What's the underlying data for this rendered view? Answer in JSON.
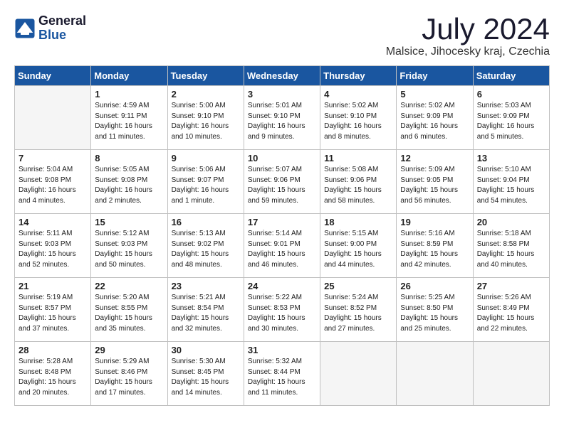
{
  "header": {
    "logo_line1": "General",
    "logo_line2": "Blue",
    "month_title": "July 2024",
    "location": "Malsice, Jihocesky kraj, Czechia"
  },
  "days_of_week": [
    "Sunday",
    "Monday",
    "Tuesday",
    "Wednesday",
    "Thursday",
    "Friday",
    "Saturday"
  ],
  "weeks": [
    [
      {
        "day": "",
        "empty": true
      },
      {
        "day": "1",
        "sunrise": "Sunrise: 4:59 AM",
        "sunset": "Sunset: 9:11 PM",
        "daylight": "Daylight: 16 hours and 11 minutes."
      },
      {
        "day": "2",
        "sunrise": "Sunrise: 5:00 AM",
        "sunset": "Sunset: 9:10 PM",
        "daylight": "Daylight: 16 hours and 10 minutes."
      },
      {
        "day": "3",
        "sunrise": "Sunrise: 5:01 AM",
        "sunset": "Sunset: 9:10 PM",
        "daylight": "Daylight: 16 hours and 9 minutes."
      },
      {
        "day": "4",
        "sunrise": "Sunrise: 5:02 AM",
        "sunset": "Sunset: 9:10 PM",
        "daylight": "Daylight: 16 hours and 8 minutes."
      },
      {
        "day": "5",
        "sunrise": "Sunrise: 5:02 AM",
        "sunset": "Sunset: 9:09 PM",
        "daylight": "Daylight: 16 hours and 6 minutes."
      },
      {
        "day": "6",
        "sunrise": "Sunrise: 5:03 AM",
        "sunset": "Sunset: 9:09 PM",
        "daylight": "Daylight: 16 hours and 5 minutes."
      }
    ],
    [
      {
        "day": "7",
        "sunrise": "Sunrise: 5:04 AM",
        "sunset": "Sunset: 9:08 PM",
        "daylight": "Daylight: 16 hours and 4 minutes."
      },
      {
        "day": "8",
        "sunrise": "Sunrise: 5:05 AM",
        "sunset": "Sunset: 9:08 PM",
        "daylight": "Daylight: 16 hours and 2 minutes."
      },
      {
        "day": "9",
        "sunrise": "Sunrise: 5:06 AM",
        "sunset": "Sunset: 9:07 PM",
        "daylight": "Daylight: 16 hours and 1 minute."
      },
      {
        "day": "10",
        "sunrise": "Sunrise: 5:07 AM",
        "sunset": "Sunset: 9:06 PM",
        "daylight": "Daylight: 15 hours and 59 minutes."
      },
      {
        "day": "11",
        "sunrise": "Sunrise: 5:08 AM",
        "sunset": "Sunset: 9:06 PM",
        "daylight": "Daylight: 15 hours and 58 minutes."
      },
      {
        "day": "12",
        "sunrise": "Sunrise: 5:09 AM",
        "sunset": "Sunset: 9:05 PM",
        "daylight": "Daylight: 15 hours and 56 minutes."
      },
      {
        "day": "13",
        "sunrise": "Sunrise: 5:10 AM",
        "sunset": "Sunset: 9:04 PM",
        "daylight": "Daylight: 15 hours and 54 minutes."
      }
    ],
    [
      {
        "day": "14",
        "sunrise": "Sunrise: 5:11 AM",
        "sunset": "Sunset: 9:03 PM",
        "daylight": "Daylight: 15 hours and 52 minutes."
      },
      {
        "day": "15",
        "sunrise": "Sunrise: 5:12 AM",
        "sunset": "Sunset: 9:03 PM",
        "daylight": "Daylight: 15 hours and 50 minutes."
      },
      {
        "day": "16",
        "sunrise": "Sunrise: 5:13 AM",
        "sunset": "Sunset: 9:02 PM",
        "daylight": "Daylight: 15 hours and 48 minutes."
      },
      {
        "day": "17",
        "sunrise": "Sunrise: 5:14 AM",
        "sunset": "Sunset: 9:01 PM",
        "daylight": "Daylight: 15 hours and 46 minutes."
      },
      {
        "day": "18",
        "sunrise": "Sunrise: 5:15 AM",
        "sunset": "Sunset: 9:00 PM",
        "daylight": "Daylight: 15 hours and 44 minutes."
      },
      {
        "day": "19",
        "sunrise": "Sunrise: 5:16 AM",
        "sunset": "Sunset: 8:59 PM",
        "daylight": "Daylight: 15 hours and 42 minutes."
      },
      {
        "day": "20",
        "sunrise": "Sunrise: 5:18 AM",
        "sunset": "Sunset: 8:58 PM",
        "daylight": "Daylight: 15 hours and 40 minutes."
      }
    ],
    [
      {
        "day": "21",
        "sunrise": "Sunrise: 5:19 AM",
        "sunset": "Sunset: 8:57 PM",
        "daylight": "Daylight: 15 hours and 37 minutes."
      },
      {
        "day": "22",
        "sunrise": "Sunrise: 5:20 AM",
        "sunset": "Sunset: 8:55 PM",
        "daylight": "Daylight: 15 hours and 35 minutes."
      },
      {
        "day": "23",
        "sunrise": "Sunrise: 5:21 AM",
        "sunset": "Sunset: 8:54 PM",
        "daylight": "Daylight: 15 hours and 32 minutes."
      },
      {
        "day": "24",
        "sunrise": "Sunrise: 5:22 AM",
        "sunset": "Sunset: 8:53 PM",
        "daylight": "Daylight: 15 hours and 30 minutes."
      },
      {
        "day": "25",
        "sunrise": "Sunrise: 5:24 AM",
        "sunset": "Sunset: 8:52 PM",
        "daylight": "Daylight: 15 hours and 27 minutes."
      },
      {
        "day": "26",
        "sunrise": "Sunrise: 5:25 AM",
        "sunset": "Sunset: 8:50 PM",
        "daylight": "Daylight: 15 hours and 25 minutes."
      },
      {
        "day": "27",
        "sunrise": "Sunrise: 5:26 AM",
        "sunset": "Sunset: 8:49 PM",
        "daylight": "Daylight: 15 hours and 22 minutes."
      }
    ],
    [
      {
        "day": "28",
        "sunrise": "Sunrise: 5:28 AM",
        "sunset": "Sunset: 8:48 PM",
        "daylight": "Daylight: 15 hours and 20 minutes."
      },
      {
        "day": "29",
        "sunrise": "Sunrise: 5:29 AM",
        "sunset": "Sunset: 8:46 PM",
        "daylight": "Daylight: 15 hours and 17 minutes."
      },
      {
        "day": "30",
        "sunrise": "Sunrise: 5:30 AM",
        "sunset": "Sunset: 8:45 PM",
        "daylight": "Daylight: 15 hours and 14 minutes."
      },
      {
        "day": "31",
        "sunrise": "Sunrise: 5:32 AM",
        "sunset": "Sunset: 8:44 PM",
        "daylight": "Daylight: 15 hours and 11 minutes."
      },
      {
        "day": "",
        "empty": true
      },
      {
        "day": "",
        "empty": true
      },
      {
        "day": "",
        "empty": true
      }
    ]
  ]
}
